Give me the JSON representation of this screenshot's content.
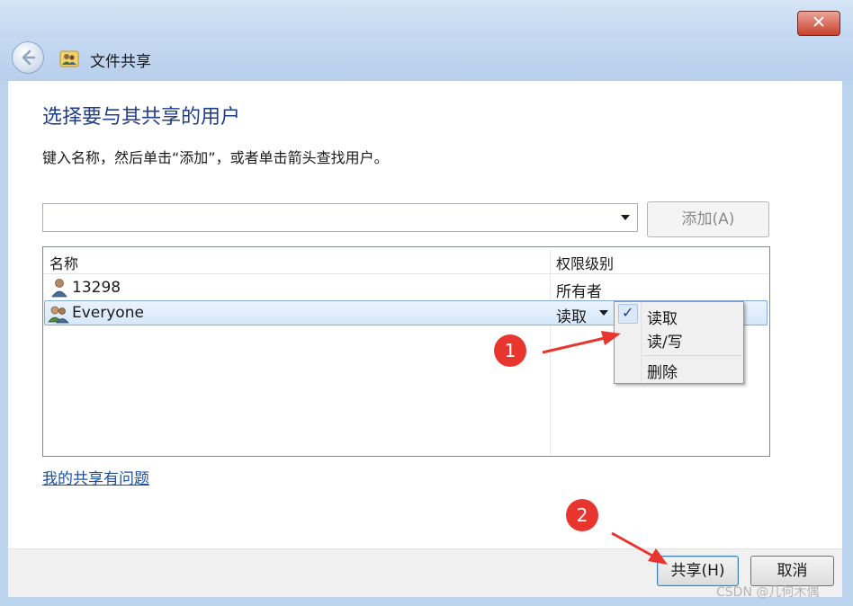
{
  "window": {
    "title": "文件共享",
    "close_glyph": "✕"
  },
  "main": {
    "heading": "选择要与其共享的用户",
    "instruction": "键入名称，然后单击“添加”，或者单击箭头查找用户。",
    "name_input": {
      "value": "",
      "placeholder": ""
    },
    "add_button": "添加(A)"
  },
  "table": {
    "columns": [
      "名称",
      "权限级别"
    ],
    "rows": [
      {
        "name": "13298",
        "permission": "所有者",
        "icon": "user-icon",
        "selected": false
      },
      {
        "name": "Everyone",
        "permission": "读取",
        "icon": "users-group-icon",
        "selected": true
      }
    ]
  },
  "permission_menu": {
    "items": [
      {
        "label": "读取",
        "checked": true
      },
      {
        "label": "读/写",
        "checked": false
      },
      {
        "label": "删除",
        "checked": false
      }
    ],
    "check_glyph": "✓"
  },
  "help_link": "我的共享有问题",
  "footer": {
    "share_button": "共享(H)",
    "cancel_button": "取消"
  },
  "annotations": {
    "step1": "1",
    "step2": "2",
    "color": "#e8352e"
  },
  "watermark": "CSDN @几何木偶"
}
